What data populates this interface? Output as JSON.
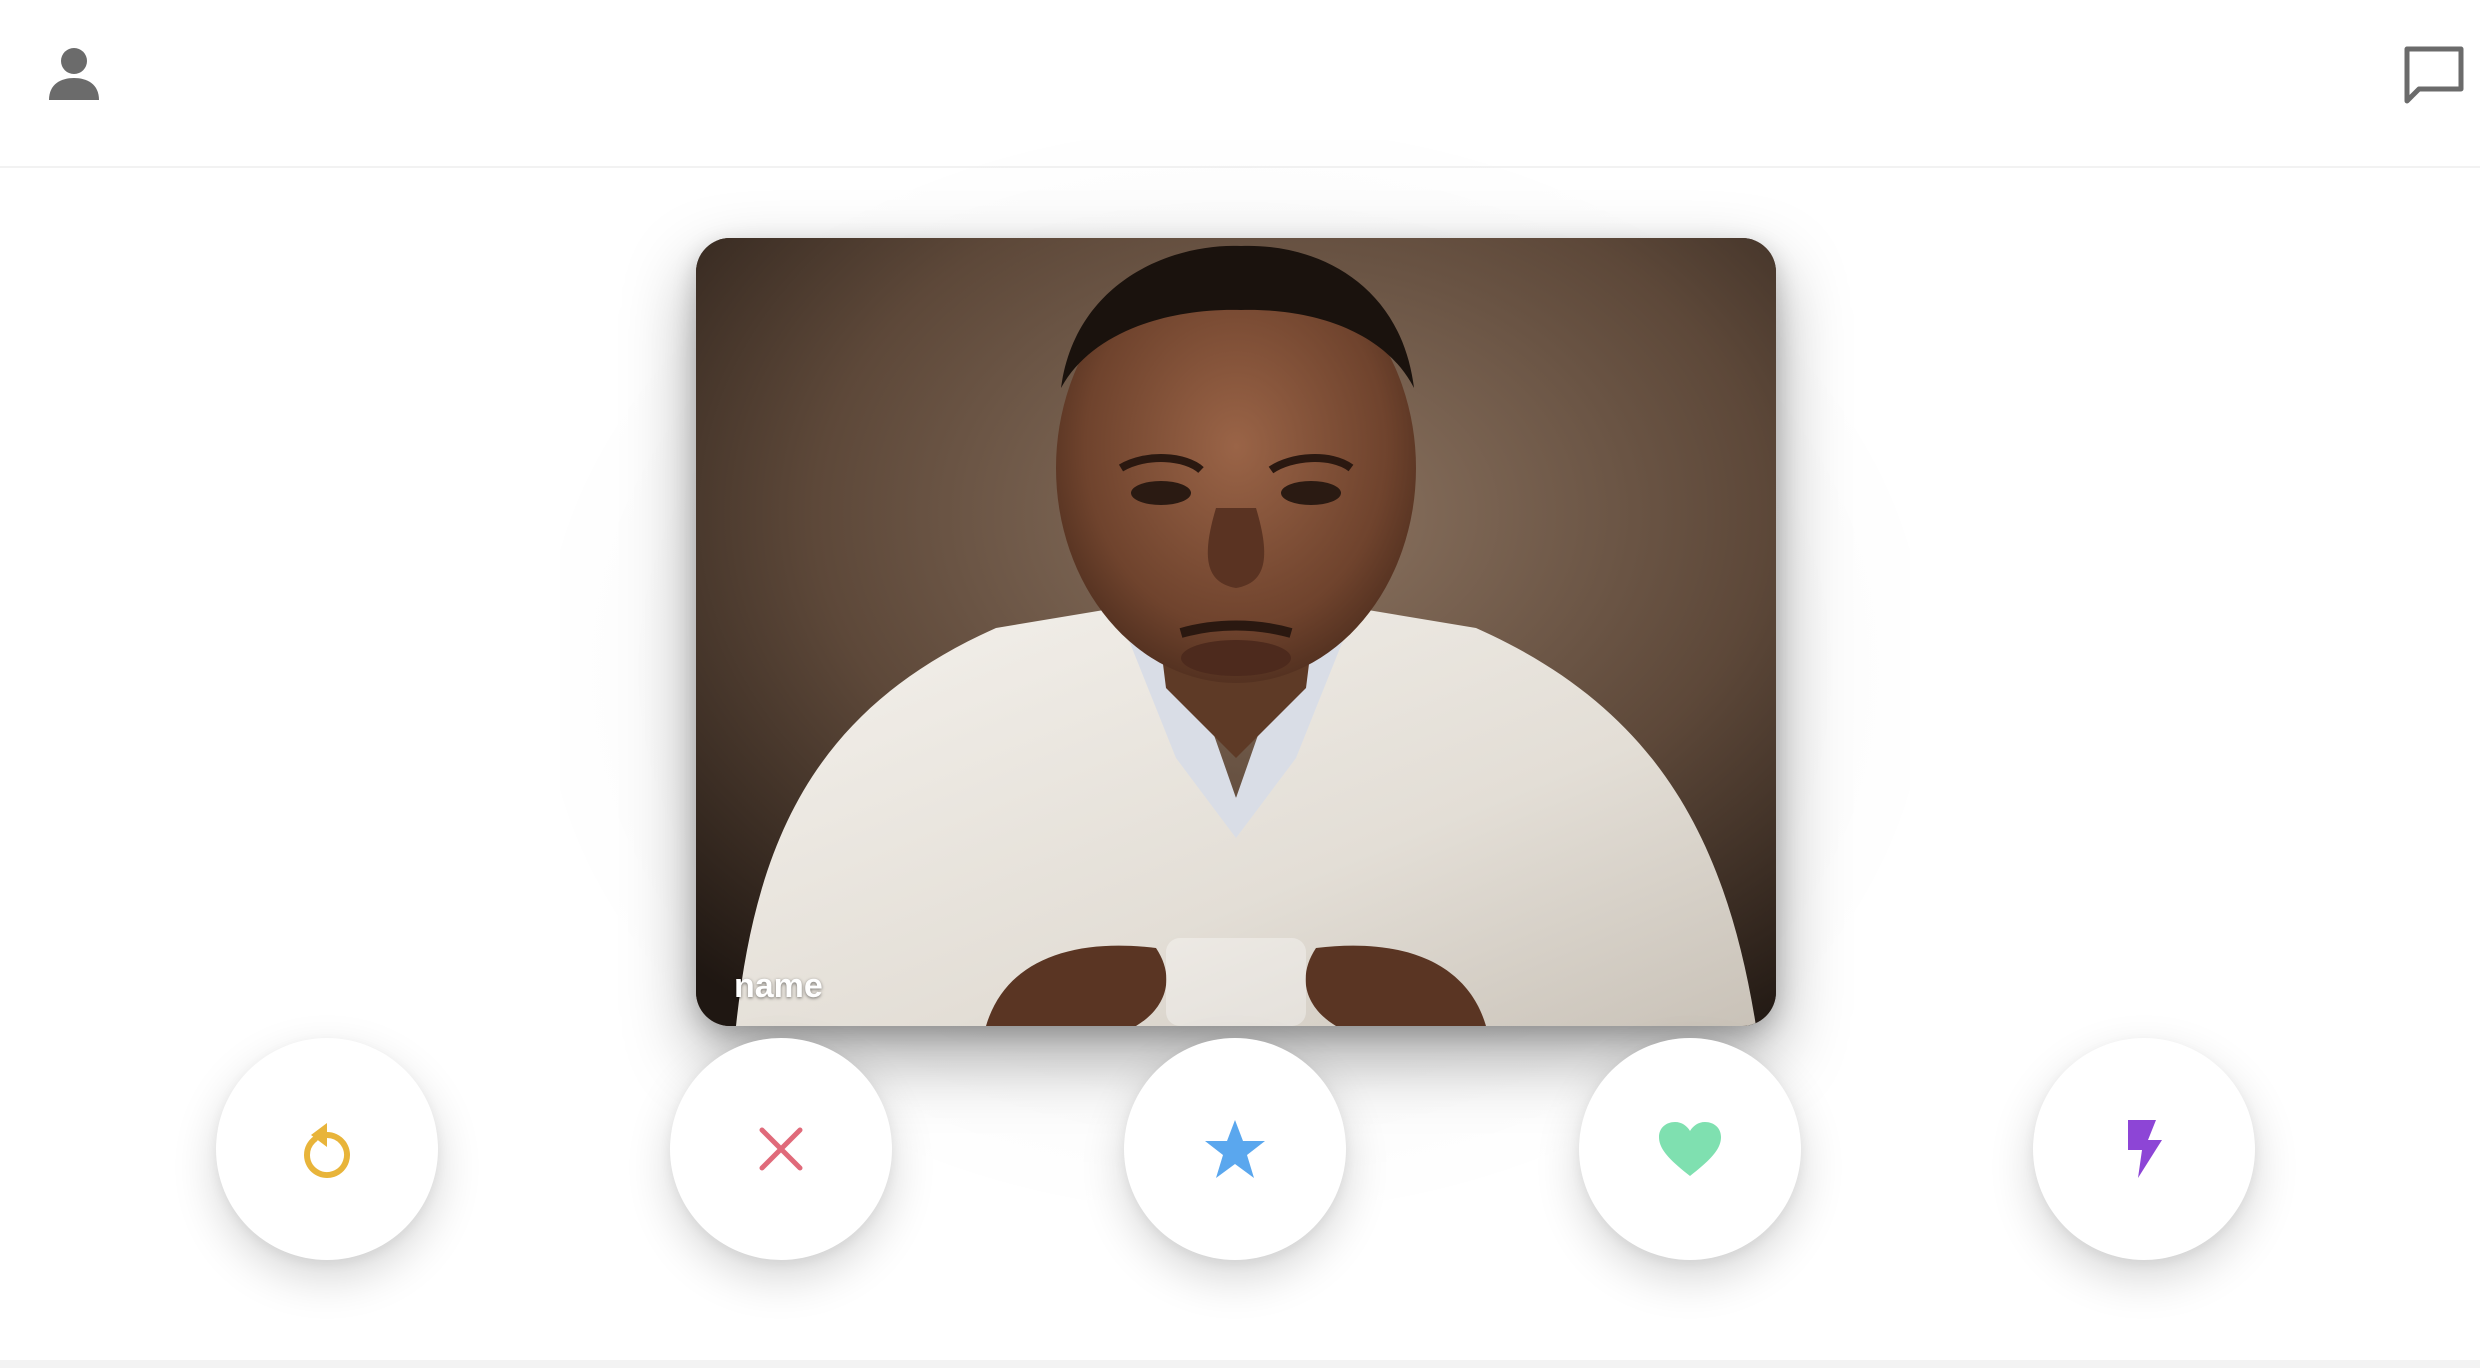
{
  "header": {
    "profile_icon": "person-icon",
    "messages_icon": "chat-bubble-icon"
  },
  "card": {
    "name": "name",
    "photo": "portrait-photo"
  },
  "actions": [
    {
      "id": "rewind",
      "icon": "rewind-icon",
      "color": "#e8b43a"
    },
    {
      "id": "nope",
      "icon": "close-icon",
      "color": "#e06a7a"
    },
    {
      "id": "superlike",
      "icon": "star-icon",
      "color": "#5aa7ee"
    },
    {
      "id": "like",
      "icon": "heart-icon",
      "color": "#7fe0b0"
    },
    {
      "id": "boost",
      "icon": "lightning-icon",
      "color": "#8d45d6"
    }
  ],
  "colors": {
    "background": "#ffffff",
    "header_border": "#f2f2f2",
    "header_icon": "#6b6b6b"
  }
}
